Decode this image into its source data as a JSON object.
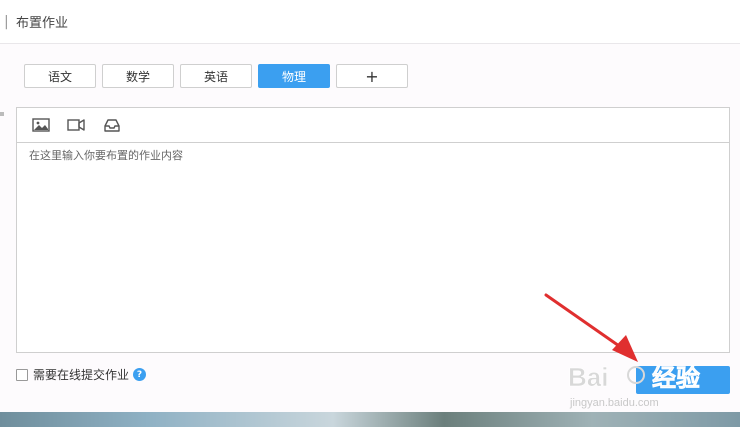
{
  "header": {
    "separator": "|",
    "title": "布置作业"
  },
  "tabs": [
    {
      "label": "语文",
      "active": false
    },
    {
      "label": "数学",
      "active": false
    },
    {
      "label": "英语",
      "active": false
    },
    {
      "label": "物理",
      "active": true
    },
    {
      "label": "+",
      "active": false
    }
  ],
  "editor": {
    "placeholder": "在这里输入你要布置的作业内容",
    "toolbar_icons": [
      "image-icon",
      "video-icon",
      "inbox-icon"
    ]
  },
  "online_submit": {
    "label": "需要在线提交作业",
    "checked": false,
    "help_glyph": "?"
  },
  "watermark": {
    "brand": "Bai",
    "brand_suffix": "经验",
    "url": "jingyan.baidu.com"
  },
  "colors": {
    "accent": "#3b9ff0",
    "arrow": "#e02f2f"
  }
}
